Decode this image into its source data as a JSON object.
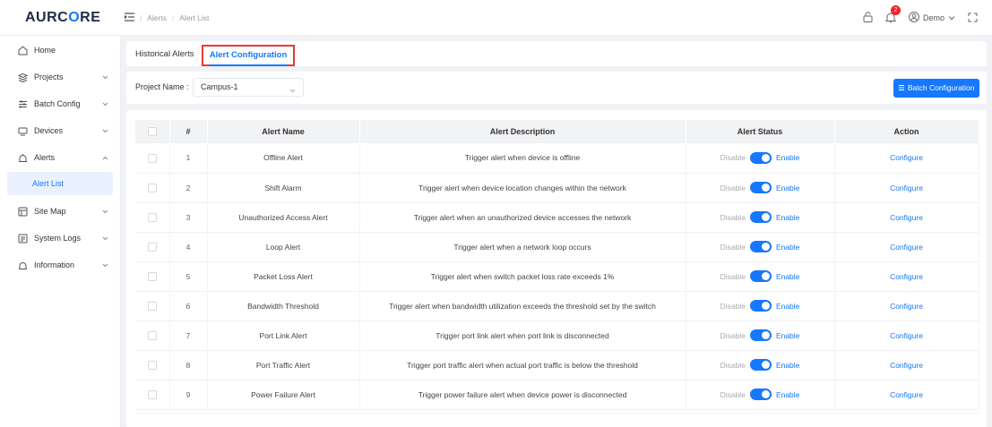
{
  "app": {
    "logo_prefix": "AURC",
    "logo_accent": "O",
    "logo_suffix": "RE",
    "brand_color": "#1677ff"
  },
  "header": {
    "breadcrumb": [
      "Alerts",
      "Alert List"
    ],
    "notification_count": "2",
    "user_name": "Demo",
    "icons": [
      "menu-fold-icon",
      "lock-icon",
      "bell-icon",
      "user-circle-icon",
      "chevron-down-icon",
      "fullscreen-icon"
    ]
  },
  "sidebar": {
    "items": [
      {
        "label": "Home",
        "icon": "home-icon",
        "expandable": false
      },
      {
        "label": "Projects",
        "icon": "layers-icon",
        "expandable": true
      },
      {
        "label": "Batch Config",
        "icon": "sliders-icon",
        "expandable": true
      },
      {
        "label": "Devices",
        "icon": "monitor-icon",
        "expandable": true
      },
      {
        "label": "Alerts",
        "icon": "alert-icon",
        "expandable": true,
        "expanded": true
      },
      {
        "label": "Site Map",
        "icon": "map-icon",
        "expandable": true
      },
      {
        "label": "System Logs",
        "icon": "log-icon",
        "expandable": true
      },
      {
        "label": "Information",
        "icon": "info-icon",
        "expandable": true
      }
    ],
    "active_sub_item": "Alert List"
  },
  "tabs": {
    "historical": "Historical Alerts",
    "configuration": "Alert Configuration",
    "active": "Alert Configuration"
  },
  "filter": {
    "project_label": "Project Name :",
    "project_value": "Campus-1",
    "batch_button": "Batch Configuration"
  },
  "table": {
    "columns": [
      "#",
      "Alert Name",
      "Alert Description",
      "Alert Status",
      "Action"
    ],
    "disable_label": "Disable",
    "enable_label": "Enable",
    "action_label": "Configure",
    "rows": [
      {
        "index": "1",
        "name": "Offline Alert",
        "description": "Trigger alert when device is offline",
        "enabled": true
      },
      {
        "index": "2",
        "name": "Shift Alarm",
        "description": "Trigger alert when device location changes within the network",
        "enabled": true
      },
      {
        "index": "3",
        "name": "Unauthorized Access Alert",
        "description": "Trigger alert when an unauthorized device accesses the network",
        "enabled": true
      },
      {
        "index": "4",
        "name": "Loop Alert",
        "description": "Trigger alert when a network loop occurs",
        "enabled": true
      },
      {
        "index": "5",
        "name": "Packet Loss Alert",
        "description": "Trigger alert when switch packet loss rate exceeds 1%",
        "enabled": true
      },
      {
        "index": "6",
        "name": "Bandwidth Threshold",
        "description": "Trigger alert when bandwidth utilization exceeds the threshold set by the switch",
        "enabled": true
      },
      {
        "index": "7",
        "name": "Port Link Alert",
        "description": "Trigger port link alert when port link is disconnected",
        "enabled": true
      },
      {
        "index": "8",
        "name": "Port Traffic Alert",
        "description": "Trigger port traffic alert when actual port traffic is below the threshold",
        "enabled": true
      },
      {
        "index": "9",
        "name": "Power Failure Alert",
        "description": "Trigger power failure alert when device power is disconnected",
        "enabled": true
      }
    ]
  }
}
